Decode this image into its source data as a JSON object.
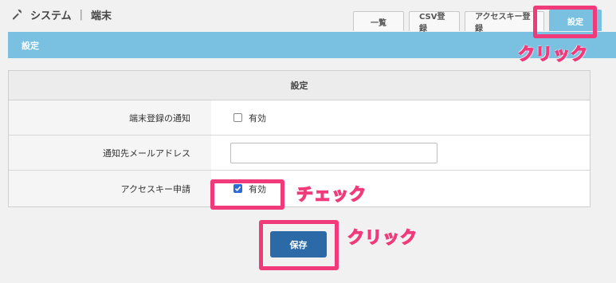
{
  "header": {
    "icon": "wrench-icon",
    "section": "システム",
    "separator": "|",
    "page": "端末"
  },
  "tabs": [
    {
      "label": "一覧"
    },
    {
      "label": "CSV登録"
    },
    {
      "label": "アクセスキー登録"
    },
    {
      "label": "設定"
    }
  ],
  "banner": {
    "title": "設定"
  },
  "panel": {
    "title": "設定",
    "rows": [
      {
        "label": "端末登録の通知",
        "checkbox_label": "有効",
        "checked": false
      },
      {
        "label": "通知先メールアドレス",
        "input_value": ""
      },
      {
        "label": "アクセスキー申請",
        "checkbox_label": "有効",
        "checked": true
      }
    ]
  },
  "actions": {
    "save_label": "保存"
  },
  "annotations": {
    "click_tab": "クリック",
    "check": "チェック",
    "click_save": "クリック"
  },
  "colors": {
    "accent": "#7ac0e0",
    "save_button": "#2b6aa7",
    "highlight": "#f03a79",
    "checkbox_checked": "#2a6cd6"
  }
}
